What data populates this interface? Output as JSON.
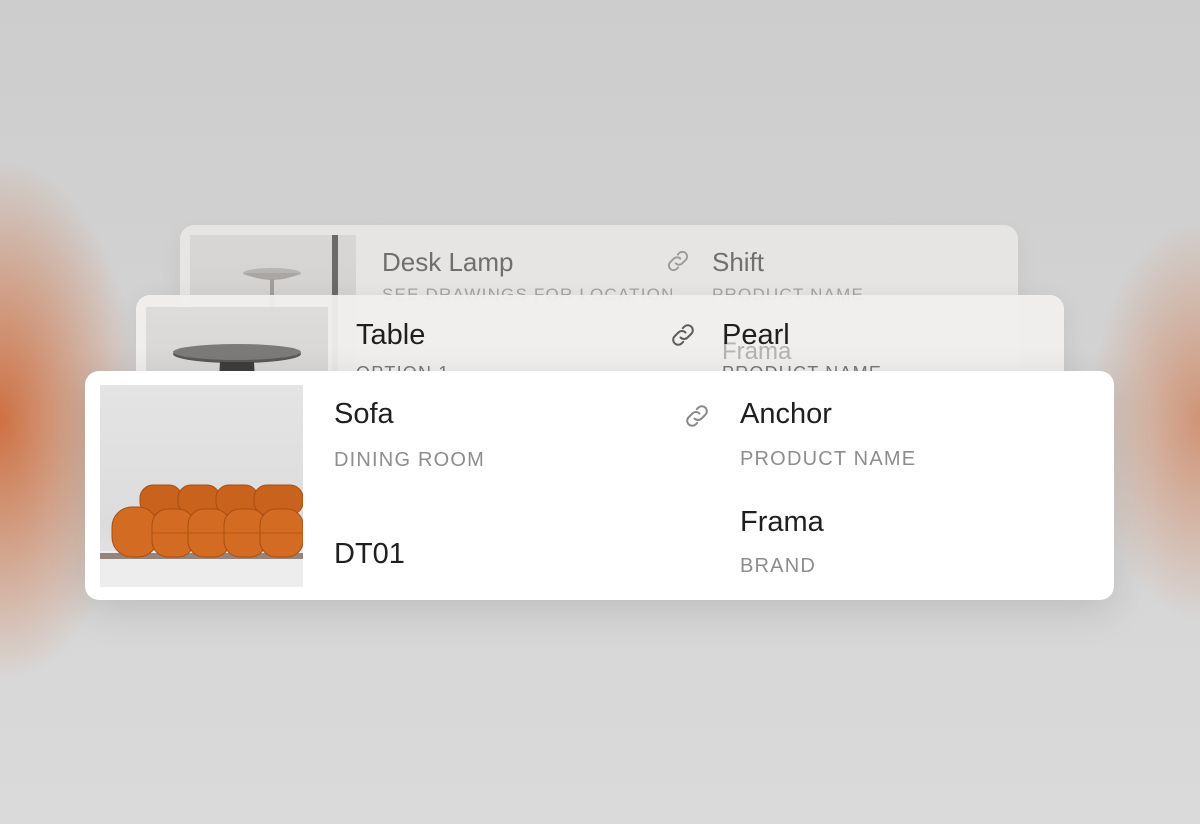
{
  "cards": {
    "back": {
      "item_name": "Desk Lamp",
      "item_location": "SEE DRAWINGS FOR LOCATION",
      "product_value": "Shift",
      "product_label": "PRODUCT NAME",
      "image_icon": "desk-lamp-image",
      "link_icon": "link-icon"
    },
    "middle": {
      "item_name": "Table",
      "item_location": "OPTION 1",
      "product_value": "Pearl",
      "product_label": "PRODUCT NAME",
      "brand_value_ghost": "Frama",
      "image_icon": "table-image",
      "link_icon": "link-icon"
    },
    "front": {
      "item_name": "Sofa",
      "item_location": "DINING ROOM",
      "item_code": "DT01",
      "product_value": "Anchor",
      "product_label": "PRODUCT NAME",
      "brand_value": "Frama",
      "brand_label": "BRAND",
      "image_icon": "sofa-image",
      "link_icon": "link-icon",
      "sofa_color": "#c9621c"
    }
  }
}
